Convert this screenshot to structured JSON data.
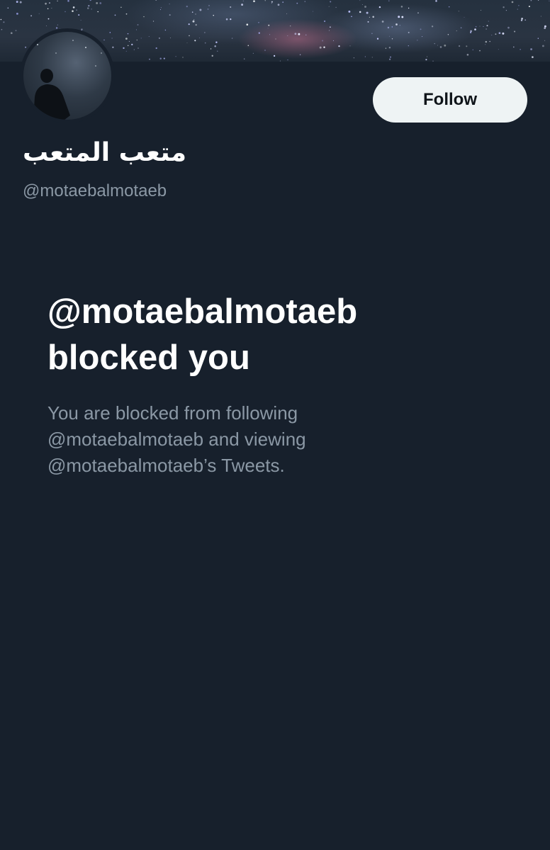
{
  "colors": {
    "background": "#17202c",
    "banner": "#25313f",
    "primary_text": "#ffffff",
    "secondary_text": "#8b98a5",
    "follow_button_bg": "#eef3f4",
    "follow_button_text": "#0f1419"
  },
  "profile": {
    "display_name": "متعب المتعب",
    "handle": "@motaebalmotaeb",
    "banner_image": "starry-night-sky",
    "avatar_image": "silhouette-under-night-sky"
  },
  "actions": {
    "follow_label": "Follow"
  },
  "blocked_notice": {
    "title_line1": "@motaebalmotaeb",
    "title_line2": "blocked you",
    "description_line1": "You are blocked from following",
    "description_line2": "@motaebalmotaeb and viewing",
    "description_line3": "@motaebalmotaeb’s Tweets."
  }
}
